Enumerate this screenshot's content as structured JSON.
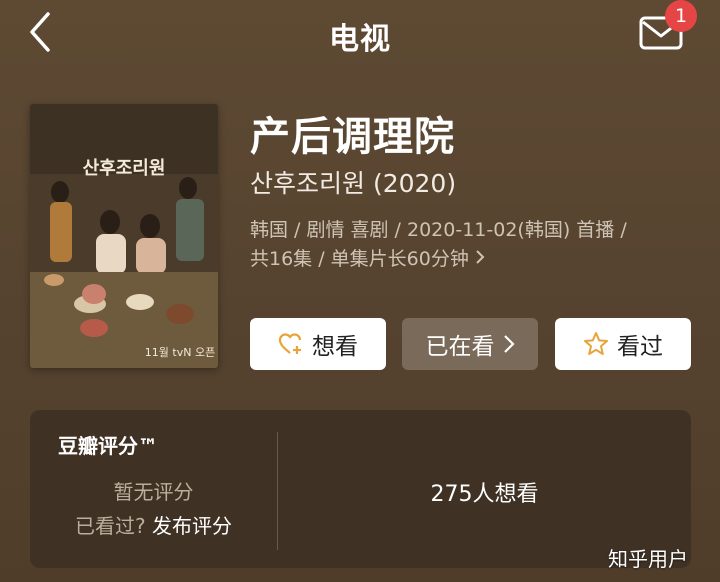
{
  "header": {
    "title": "电视",
    "notification_count": "1"
  },
  "show": {
    "title": "产后调理院",
    "original_title": "산후조리원 (2020)",
    "meta_line1": "韩国 / 剧情 喜剧 / 2020-11-02(韩国) 首播 /",
    "meta_line2": "共16集 / 单集片长60分钟"
  },
  "poster": {
    "title_korean": "산후조리원",
    "tagline_korean": "11월 tvN 오픈"
  },
  "actions": {
    "want_label": "想看",
    "watching_label": "已在看",
    "watched_label": "看过"
  },
  "rating": {
    "title": "豆瓣评分™",
    "no_rating": "暂无评分",
    "seen_prefix": "已看过?",
    "publish_label": "发布评分",
    "wish_count": "275人想看"
  },
  "watermark": "知乎用户",
  "colors": {
    "background": "#574430",
    "card": "#3f3124",
    "accent_icon": "#e8a33a",
    "badge": "#e64545"
  }
}
